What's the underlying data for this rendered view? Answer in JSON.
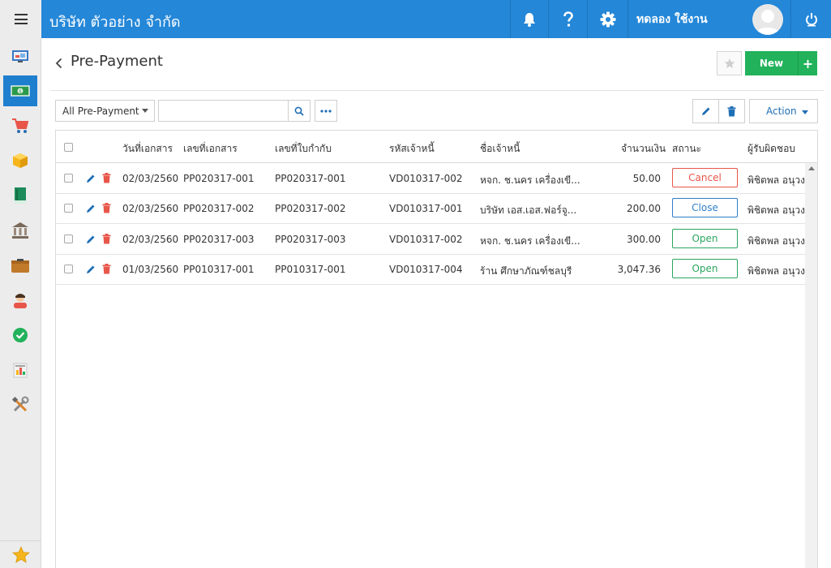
{
  "app": {
    "company_name": "บริษัท ตัวอย่าง จำกัด",
    "user_name": "ทดลอง ใช้งาน"
  },
  "page": {
    "title": "Pre-Payment",
    "new_label": "New",
    "plus_label": "+"
  },
  "toolbar": {
    "filter_value": "All Pre-Payment",
    "search_value": "",
    "action_label": "Action"
  },
  "table": {
    "headers": {
      "doc_date": "วันที่เอกสาร",
      "doc_no": "เลขที่เอกสาร",
      "invoice_no": "เลขที่ใบกำกับ",
      "creditor_code": "รหัสเจ้าหนี้",
      "creditor_name": "ชื่อเจ้าหนี้",
      "amount": "จำนวนเงิน",
      "status": "สถานะ",
      "owner": "ผู้รับผิดชอบ"
    },
    "rows": [
      {
        "doc_date": "02/03/2560",
        "doc_no": "PP020317-001",
        "invoice_no": "PP020317-001",
        "creditor_code": "VD010317-002",
        "creditor_name": "หจก. ช.นคร เครื่องเขี...",
        "amount": "50.00",
        "status": "Cancel",
        "owner": "พิชิตพล อนุวงศ์"
      },
      {
        "doc_date": "02/03/2560",
        "doc_no": "PP020317-002",
        "invoice_no": "PP020317-002",
        "creditor_code": "VD010317-001",
        "creditor_name": "บริษัท เอส.เอส.ฟอร์จู...",
        "amount": "200.00",
        "status": "Close",
        "owner": "พิชิตพล อนุวงศ์"
      },
      {
        "doc_date": "02/03/2560",
        "doc_no": "PP020317-003",
        "invoice_no": "PP020317-003",
        "creditor_code": "VD010317-002",
        "creditor_name": "หจก. ช.นคร เครื่องเขี...",
        "amount": "300.00",
        "status": "Open",
        "owner": "พิชิตพล อนุวงศ์"
      },
      {
        "doc_date": "01/03/2560",
        "doc_no": "PP010317-001",
        "invoice_no": "PP010317-001",
        "creditor_code": "VD010317-004",
        "creditor_name": "ร้าน ศึกษาภัณฑ์ชลบุรี",
        "amount": "3,047.36",
        "status": "Open",
        "owner": "พิชิตพล อนุวงศ์"
      }
    ]
  },
  "icons": {
    "sidebar": [
      "dashboard-icon",
      "money-icon",
      "cart-icon",
      "box-icon",
      "book-icon",
      "bank-icon",
      "wallet-icon",
      "person-icon",
      "check-icon",
      "report-icon",
      "tools-icon"
    ],
    "topbar": [
      "bell-icon",
      "help-icon",
      "gear-icon",
      "power-icon"
    ]
  },
  "colors": {
    "topbar": "#2487d8",
    "sidebar_active": "#1f7fcf",
    "new_button": "#22b25b",
    "status_cancel": "#e8564a",
    "status_close": "#2f7fc8",
    "status_open": "#2aa55e"
  }
}
